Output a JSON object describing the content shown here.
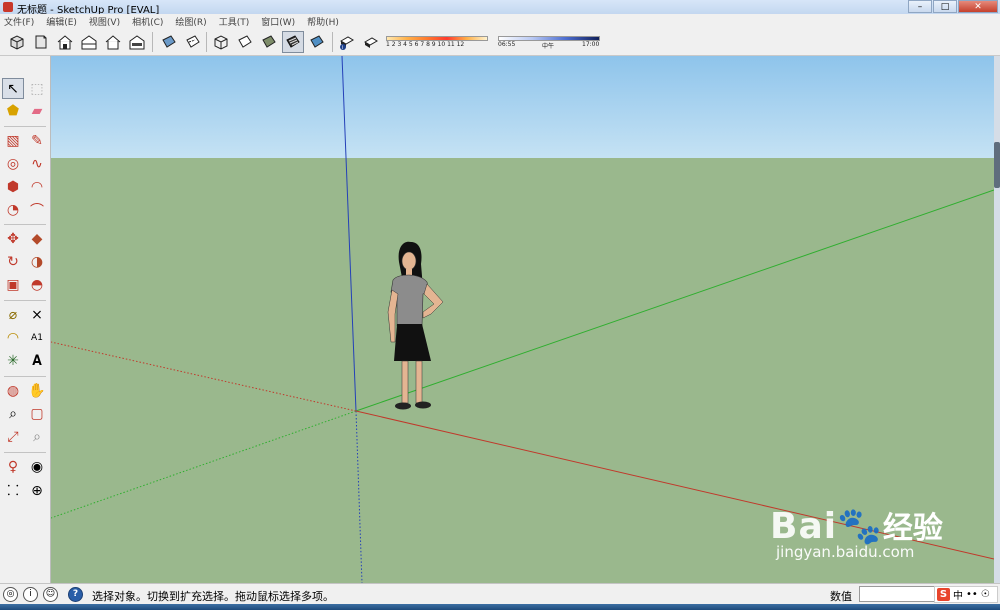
{
  "window": {
    "title": "无标题 - SketchUp Pro [EVAL]"
  },
  "window_controls": {
    "minimize": "–",
    "maximize": "□",
    "close": "✕"
  },
  "menu": [
    "文件(F)",
    "编辑(E)",
    "视图(V)",
    "相机(C)",
    "绘图(R)",
    "工具(T)",
    "窗口(W)",
    "帮助(H)"
  ],
  "shadow_settings": {
    "month_scale": "1 2 3 4 5 6 7 8 9 10 11 12",
    "time_start": "06:55",
    "time_mid": "中午",
    "time_end": "17:00"
  },
  "status": {
    "message": "选择对象。切换到扩充选择。拖动鼠标选择多项。",
    "measurement_label": "数值",
    "ime_lang": "中"
  },
  "watermark": {
    "logo_latin": "Bai",
    "logo_cn": "经验",
    "url": "jingyan.baidu.com"
  },
  "colors": {
    "sky_top": "#8ec4eb",
    "ground": "#9ab88d",
    "axis_red": "#c0392b",
    "axis_green": "#2fae2f",
    "axis_blue": "#2440b8"
  }
}
